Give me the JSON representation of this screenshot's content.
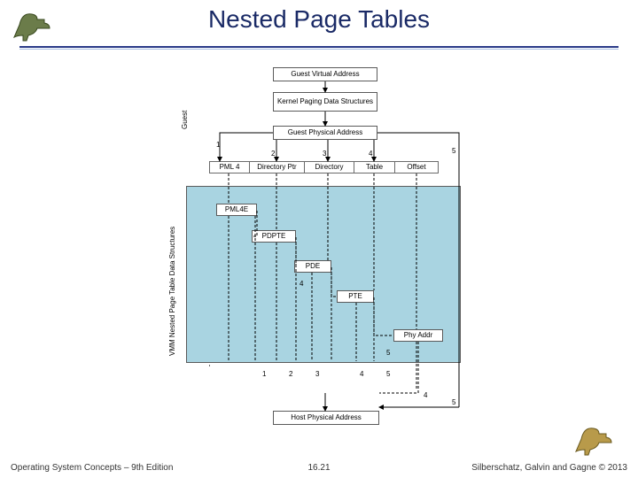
{
  "header": {
    "title": "Nested Page Tables"
  },
  "footer": {
    "left": "Operating System Concepts – 9th Edition",
    "center": "16.21",
    "right": "Silberschatz, Galvin and Gagne © 2013"
  },
  "diagram": {
    "boxes": {
      "gva": "Guest Virtual Address",
      "kpds": "Kernel Paging Data Structures",
      "gpa": "Guest Physical Address",
      "hpa": "Host Physical Address"
    },
    "rot_labels": {
      "guest": "Guest",
      "vmm": "VMM Nested Page Table Data Structures"
    },
    "top_row": [
      "PML 4",
      "Directory Ptr",
      "Directory",
      "Table",
      "Offset"
    ],
    "stage_boxes": [
      "PML4E",
      "PDPTE",
      "PDE",
      "PTE",
      "Phy Addr"
    ],
    "top_nums": [
      "1",
      "2",
      "3",
      "4",
      "5"
    ],
    "under_nums": [
      "1",
      "2",
      "3",
      "4",
      "5"
    ],
    "loop_nums": [
      "4",
      "5"
    ],
    "right_bottom_nums": [
      "4",
      "5"
    ]
  }
}
